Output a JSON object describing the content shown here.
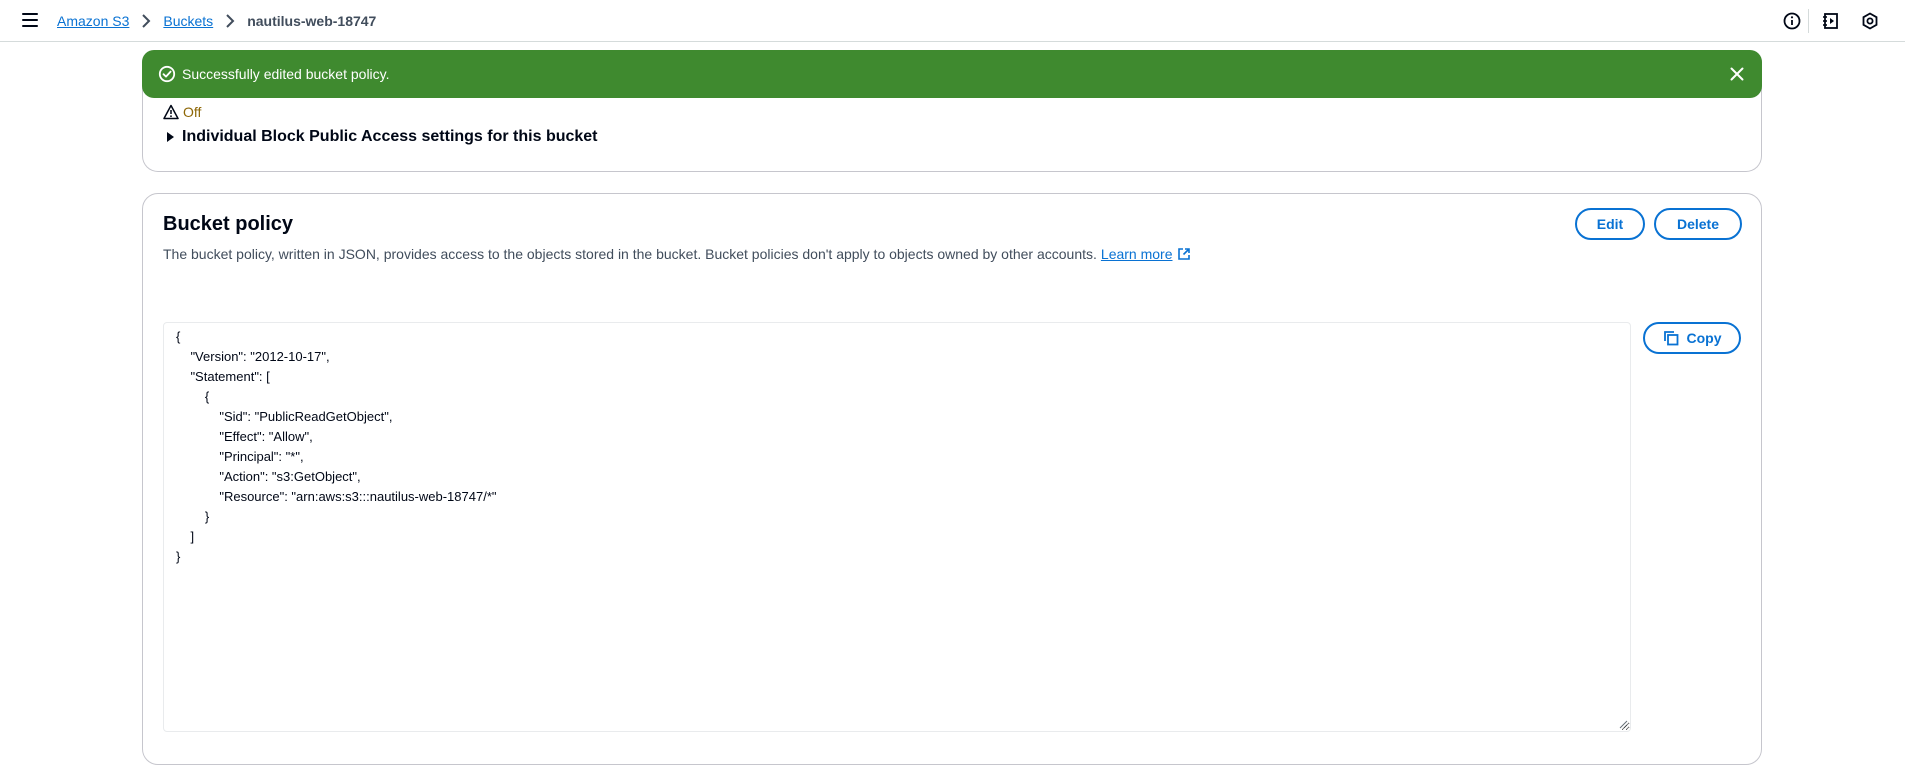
{
  "breadcrumb": {
    "items": [
      {
        "label": "Amazon S3"
      },
      {
        "label": "Buckets"
      }
    ],
    "current": "nautilus-web-18747"
  },
  "flash": {
    "message": "Successfully edited bucket policy.",
    "color": "#3f8a2f"
  },
  "block_public_access": {
    "status": "Off",
    "expander_label": "Individual Block Public Access settings for this bucket"
  },
  "bucket_policy": {
    "title": "Bucket policy",
    "description": "The bucket policy, written in JSON, provides access to the objects stored in the bucket. Bucket policies don't apply to objects owned by other accounts.",
    "learn_more": "Learn more",
    "edit_label": "Edit",
    "delete_label": "Delete",
    "copy_label": "Copy",
    "code_lines": [
      "{",
      "    \"Version\": \"2012-10-17\",",
      "    \"Statement\": [",
      "        {",
      "            \"Sid\": \"PublicReadGetObject\",",
      "            \"Effect\": \"Allow\",",
      "            \"Principal\": \"*\",",
      "            \"Action\": \"s3:GetObject\",",
      "            \"Resource\": \"arn:aws:s3:::nautilus-web-18747/*\"",
      "        }",
      "    ]",
      "}"
    ]
  },
  "colors": {
    "link": "#0972d3",
    "warning": "#8d6605",
    "success": "#3f8a2f"
  }
}
